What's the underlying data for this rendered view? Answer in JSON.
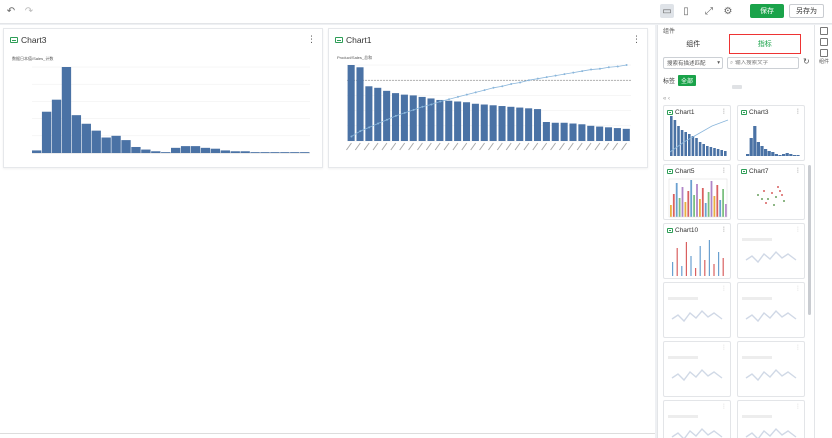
{
  "toolbar": {
    "undo_icon": "undo-icon",
    "redo_icon": "redo-icon",
    "save_label": "保存",
    "save_as_label": "另存为"
  },
  "cards": [
    {
      "title": "Chart3",
      "subtitle": "数据日本值/Sales_计数",
      "chart_data": {
        "type": "bar",
        "title": "Chart3",
        "ylabel": "数据日本值/Sales_计数",
        "values": [
          3,
          48,
          62,
          100,
          44,
          34,
          26,
          18,
          20,
          15,
          7,
          4,
          2,
          1,
          6,
          8,
          8,
          6,
          5,
          3,
          2,
          2,
          1,
          1,
          1,
          1,
          1,
          1
        ],
        "ylim": [
          0,
          100
        ]
      }
    },
    {
      "title": "Chart1",
      "subtitle": "Product/Sales_总和",
      "chart_data": {
        "type": "bar",
        "title": "Chart1",
        "ylabel": "Product/Sales_总和",
        "bar_values": [
          100,
          97,
          72,
          70,
          66,
          63,
          61,
          60,
          58,
          56,
          54,
          53,
          52,
          51,
          49,
          48,
          47,
          46,
          45,
          44,
          43,
          42,
          25,
          24,
          24,
          23,
          22,
          20,
          19,
          18,
          17,
          16
        ],
        "line_values": [
          6,
          13,
          18,
          23,
          28,
          33,
          37,
          41,
          45,
          48,
          52,
          55,
          58,
          61,
          64,
          67,
          70,
          72,
          75,
          77,
          80,
          82,
          84,
          86,
          88,
          90,
          92,
          94,
          95,
          97,
          98,
          100
        ],
        "reference_line": 80,
        "ylim": [
          0,
          100
        ]
      }
    }
  ],
  "panel": {
    "title": "组件",
    "tabs": [
      "组件",
      "指标"
    ],
    "filter_label": "搜索有描述匹配",
    "search_placeholder": "输入搜索文字",
    "tag_label": "标签",
    "tag_all": "全部",
    "thumbs": [
      {
        "title": "Chart1",
        "kind": "pareto"
      },
      {
        "title": "Chart3",
        "kind": "histogram"
      },
      {
        "title": "Chart5",
        "kind": "multibar"
      },
      {
        "title": "Chart7",
        "kind": "scatter"
      },
      {
        "title": "Chart10",
        "kind": "spikes"
      },
      {
        "title": "",
        "kind": "sparkline-faded"
      },
      {
        "title": "",
        "kind": "sparkline-faded"
      },
      {
        "title": "",
        "kind": "sparkline-faded"
      },
      {
        "title": "",
        "kind": "sparkline-faded"
      },
      {
        "title": "",
        "kind": "sparkline-faded"
      },
      {
        "title": "",
        "kind": "sparkline-faded"
      },
      {
        "title": "",
        "kind": "sparkline-faded"
      }
    ]
  },
  "strip": {
    "item_label": "组件"
  },
  "colors": {
    "accent": "#1aa34a",
    "bar": "#4a72a5",
    "line": "#8ab6db",
    "highlight_border": "#e33333"
  }
}
